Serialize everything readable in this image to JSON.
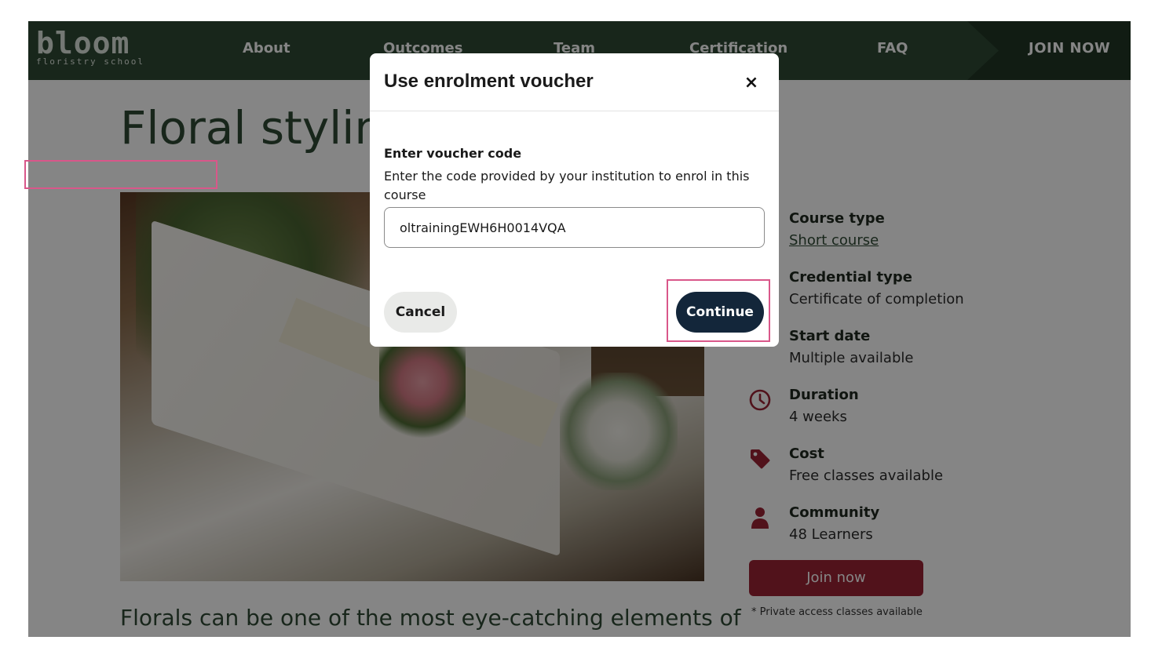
{
  "brand": {
    "name": "bloom",
    "tagline": "floristry school"
  },
  "nav": {
    "items": [
      {
        "label": "About"
      },
      {
        "label": "Outcomes"
      },
      {
        "label": "Team"
      },
      {
        "label": "Certification"
      },
      {
        "label": "FAQ"
      }
    ],
    "cta": "JOIN NOW"
  },
  "course": {
    "title": "Floral styling",
    "intro": "Florals can be one of the most eye-catching elements of",
    "info": [
      {
        "label": "Course type",
        "value": "Short course",
        "icon": "none"
      },
      {
        "label": "Credential type",
        "value": "Certificate of completion",
        "icon": "none"
      },
      {
        "label": "Start date",
        "value": "Multiple available",
        "icon": "none"
      },
      {
        "label": "Duration",
        "value": "4 weeks",
        "icon": "clock-icon"
      },
      {
        "label": "Cost",
        "value": "Free classes available",
        "icon": "tag-icon"
      },
      {
        "label": "Community",
        "value": "48 Learners",
        "icon": "person-icon"
      }
    ],
    "join_label": "Join now",
    "footnote": "* Private access classes available"
  },
  "modal": {
    "title": "Use enrolment voucher",
    "close_symbol": "×",
    "field_label": "Enter voucher code",
    "help_text": "Enter the code provided by your institution to enrol in this course",
    "input_value": "oltrainingEWH6H0014VQA",
    "cancel_label": "Cancel",
    "continue_label": "Continue"
  },
  "colors": {
    "header_bg": "#2f4a35",
    "accent_red": "#9b2335",
    "continue_bg": "#13263a",
    "highlight": "#d9578a"
  }
}
